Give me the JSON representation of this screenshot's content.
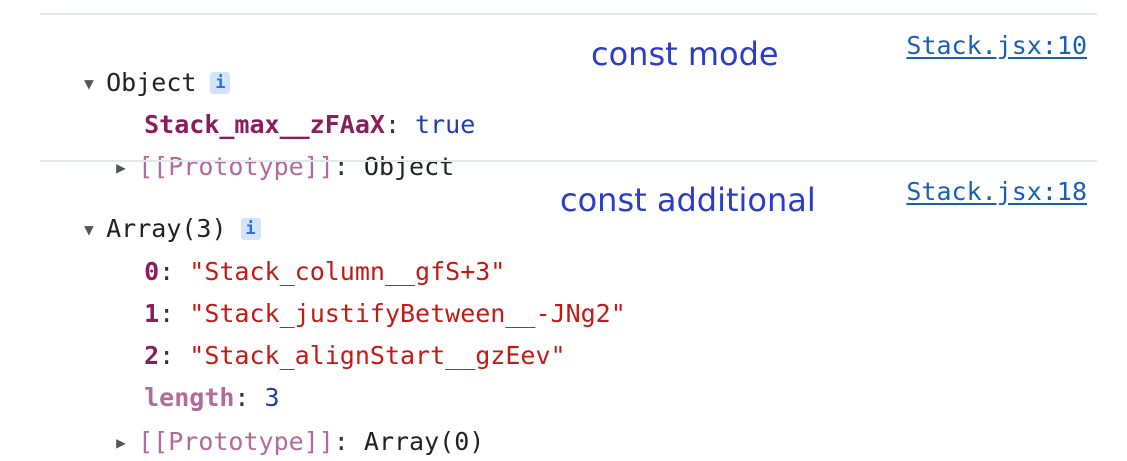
{
  "console": {
    "entries": [
      {
        "summary": "Object",
        "info_badge": "i",
        "source": "Stack.jsx:10",
        "annotation": "const mode",
        "properties": [
          {
            "key": "Stack_max__zFAaX",
            "value": "true"
          }
        ],
        "prototype": {
          "label": "[[Prototype]]",
          "value": "Object"
        }
      },
      {
        "summary": "Array(3)",
        "info_badge": "i",
        "source": "Stack.jsx:18",
        "annotation": "const additional",
        "items": [
          {
            "index": "0",
            "value": "\"Stack_column__gfS+3\""
          },
          {
            "index": "1",
            "value": "\"Stack_justifyBetween__-JNg2\""
          },
          {
            "index": "2",
            "value": "\"Stack_alignStart__gzEev\""
          }
        ],
        "length": {
          "key": "length",
          "value": "3"
        },
        "prototype": {
          "label": "[[Prototype]]",
          "value": "Array(0)"
        }
      }
    ]
  },
  "colors": {
    "divider": "#e3e7ee",
    "link": "#1a5fb4",
    "annotation": "#2b3cc6",
    "string": "#c41a16",
    "keyword": "#1f3fa8",
    "property_key": "#8a1d5c"
  },
  "icons": {
    "expanded": "triangle-down-icon",
    "collapsed": "triangle-right-icon"
  }
}
